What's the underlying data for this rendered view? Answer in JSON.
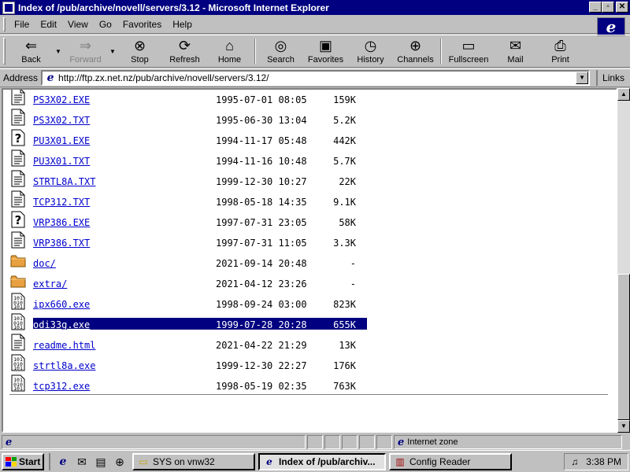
{
  "window": {
    "title": "Index of /pub/archive/novell/servers/3.12 - Microsoft Internet Explorer",
    "btn_minimize": "_",
    "btn_maximize": "▫",
    "btn_close": "✕"
  },
  "menubar": {
    "items": [
      {
        "label": "File"
      },
      {
        "label": "Edit"
      },
      {
        "label": "View"
      },
      {
        "label": "Go"
      },
      {
        "label": "Favorites"
      },
      {
        "label": "Help"
      }
    ],
    "logo_glyph": "e"
  },
  "toolbar": {
    "back": "Back",
    "forward": "Forward",
    "stop": "Stop",
    "refresh": "Refresh",
    "home": "Home",
    "search": "Search",
    "favorites": "Favorites",
    "history": "History",
    "channels": "Channels",
    "fullscreen": "Fullscreen",
    "mail": "Mail",
    "print": "Print",
    "icons": {
      "back": "left-arrow-icon",
      "forward": "right-arrow-icon",
      "stop": "stop-icon",
      "refresh": "refresh-icon",
      "home": "home-icon",
      "search": "search-icon",
      "favorites": "favorites-folder-icon",
      "history": "history-icon",
      "channels": "channels-satellite-icon",
      "fullscreen": "fullscreen-icon",
      "mail": "mail-icon",
      "print": "printer-icon"
    }
  },
  "address": {
    "label": "Address",
    "url": "http://ftp.zx.net.nz/pub/archive/novell/servers/3.12/",
    "links_label": "Links"
  },
  "listing": {
    "rows": [
      {
        "icon": "text-file-icon",
        "name": "PS3X02.EXE",
        "date": "1995-07-01 08:05",
        "size": "159K",
        "selected": false
      },
      {
        "icon": "text-file-icon",
        "name": "PS3X02.TXT",
        "date": "1995-06-30 13:04",
        "size": "5.2K",
        "selected": false
      },
      {
        "icon": "unknown-file-icon",
        "name": "PU3X01.EXE",
        "date": "1994-11-17 05:48",
        "size": "442K",
        "selected": false
      },
      {
        "icon": "text-file-icon",
        "name": "PU3X01.TXT",
        "date": "1994-11-16 10:48",
        "size": "5.7K",
        "selected": false
      },
      {
        "icon": "text-file-icon",
        "name": "STRTL8A.TXT",
        "date": "1999-12-30 10:27",
        "size": "22K",
        "selected": false
      },
      {
        "icon": "text-file-icon",
        "name": "TCP312.TXT",
        "date": "1998-05-18 14:35",
        "size": "9.1K",
        "selected": false
      },
      {
        "icon": "unknown-file-icon",
        "name": "VRP386.EXE",
        "date": "1997-07-31 23:05",
        "size": "58K",
        "selected": false
      },
      {
        "icon": "text-file-icon",
        "name": "VRP386.TXT",
        "date": "1997-07-31 11:05",
        "size": "3.3K",
        "selected": false
      },
      {
        "icon": "folder-icon",
        "name": "doc/",
        "date": "2021-09-14 20:48",
        "size": "-",
        "selected": false
      },
      {
        "icon": "folder-icon",
        "name": "extra/",
        "date": "2021-04-12 23:26",
        "size": "-",
        "selected": false
      },
      {
        "icon": "binary-file-icon",
        "name": "ipx660.exe",
        "date": "1998-09-24 03:00",
        "size": "823K",
        "selected": false
      },
      {
        "icon": "binary-file-icon",
        "name": "odi33g.exe",
        "date": "1999-07-28 20:28",
        "size": "655K",
        "selected": true
      },
      {
        "icon": "text-file-icon",
        "name": "readme.html",
        "date": "2021-04-22 21:29",
        "size": "13K",
        "selected": false
      },
      {
        "icon": "binary-file-icon",
        "name": "strtl8a.exe",
        "date": "1999-12-30 22:27",
        "size": "176K",
        "selected": false
      },
      {
        "icon": "binary-file-icon",
        "name": "tcp312.exe",
        "date": "1998-05-19 02:35",
        "size": "763K",
        "selected": false
      }
    ]
  },
  "status": {
    "zone": "Internet zone"
  },
  "taskbar": {
    "start": "Start",
    "tasks": [
      {
        "label": "SYS on vnw32",
        "icon": "folder-icon",
        "active": false
      },
      {
        "label": "Index of /pub/archiv...",
        "icon": "ie-icon",
        "active": true
      },
      {
        "label": "Config Reader",
        "icon": "config-reader-icon",
        "active": false
      }
    ],
    "clock": "3:38 PM"
  },
  "colors": {
    "titlebar": "#000080",
    "link": "#0000cc",
    "selection": "#000080",
    "chrome": "#c0c0c0"
  }
}
